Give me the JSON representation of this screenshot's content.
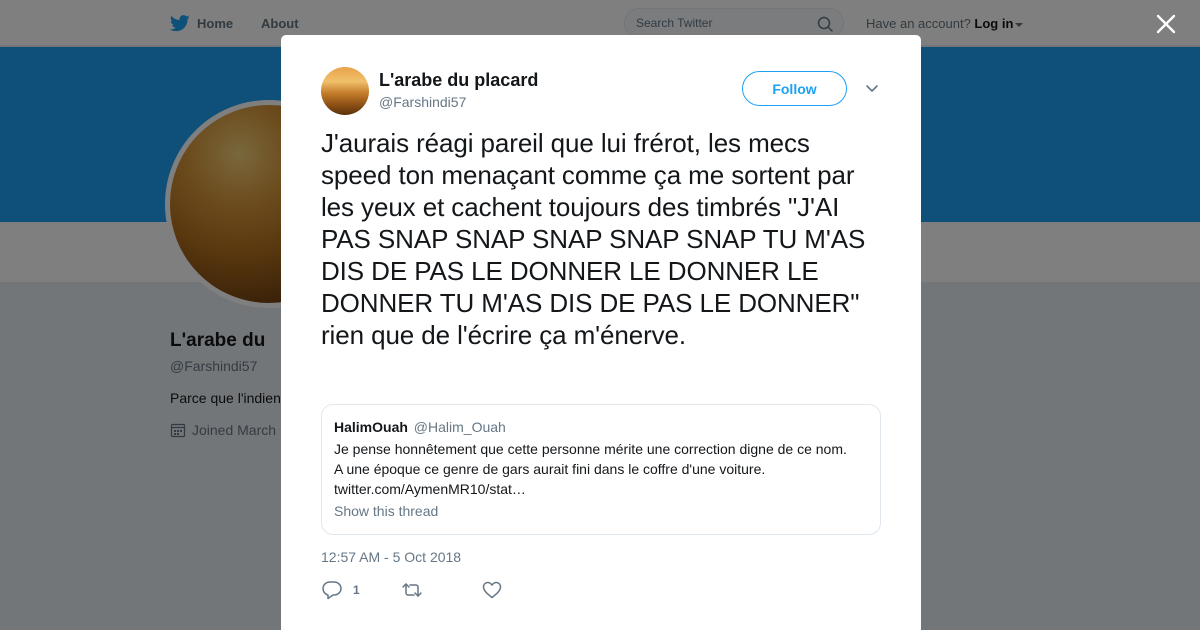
{
  "topbar": {
    "home_label": "Home",
    "about_label": "About",
    "search_placeholder": "Search Twitter",
    "account_prompt": "Have an account?",
    "login_label": "Log in"
  },
  "profile": {
    "name": "L'arabe du",
    "handle": "@Farshindi57",
    "bio": "Parce que l'indien",
    "joined": "Joined March"
  },
  "tweet": {
    "author_name": "L'arabe du placard",
    "author_handle": "@Farshindi57",
    "follow_label": "Follow",
    "text": "J'aurais réagi pareil que lui frérot, les mecs speed ton menaçant comme ça me sortent par les yeux et cachent toujours des timbrés \"J'AI PAS SNAP SNAP SNAP SNAP SNAP TU M'AS DIS DE PAS LE DONNER LE DONNER LE DONNER TU M'AS DIS DE PAS LE DONNER\" rien que de l'écrire ça m'énerve.",
    "quoted": {
      "name": "HalimOuah",
      "handle": "@Halim_Ouah",
      "line1": "Je pense honnêtement que cette personne mérite une correction digne de ce nom.",
      "line2": "A une époque ce genre de gars aurait fini dans le coffre d'une voiture.",
      "line3": "twitter.com/AymenMR10/stat…",
      "show_thread": "Show this thread"
    },
    "timestamp": "12:57 AM - 5 Oct 2018",
    "reply_count": "1"
  },
  "colors": {
    "accent": "#1da1f2",
    "text": "#14171a",
    "muted": "#657786"
  },
  "icons": [
    "twitter-bird-icon",
    "search-icon",
    "close-icon",
    "chevron-down-icon",
    "reply-icon",
    "retweet-icon",
    "heart-icon",
    "calendar-icon"
  ]
}
